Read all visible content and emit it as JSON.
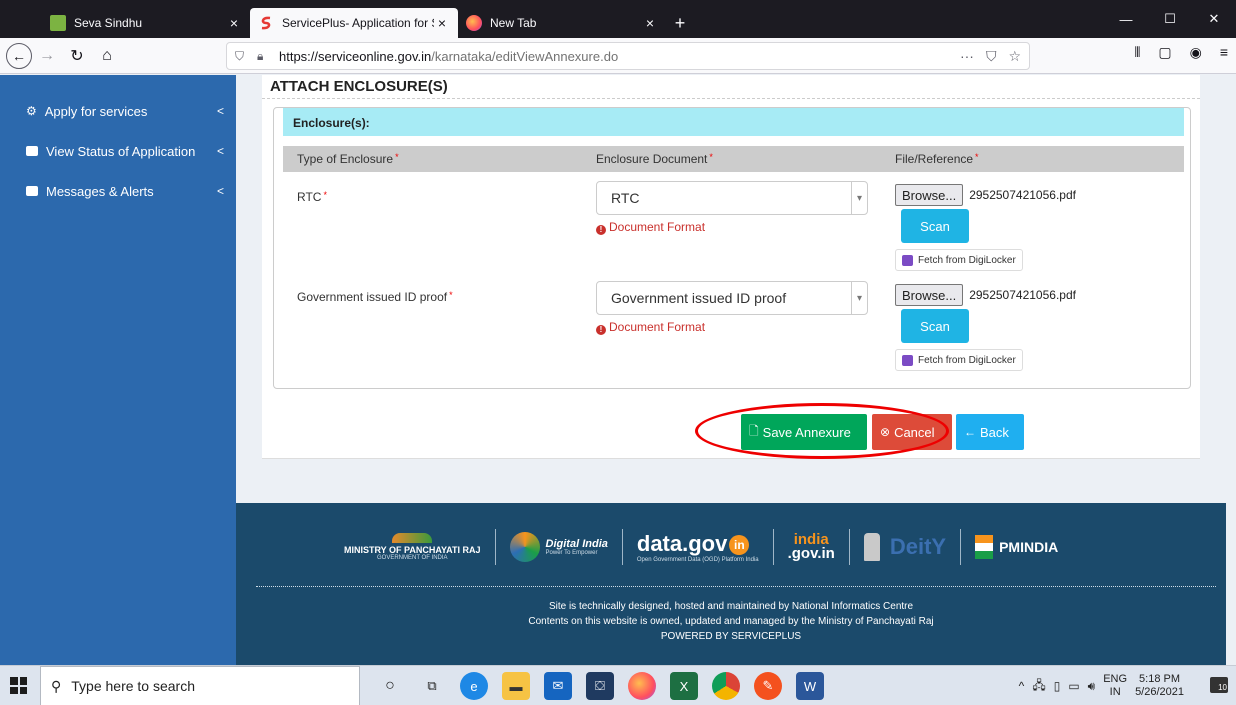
{
  "browser": {
    "tabs": [
      {
        "title": "Seva Sindhu",
        "close": "×"
      },
      {
        "title": "ServicePlus- Application for Se",
        "close": "×"
      },
      {
        "title": "New Tab",
        "close": "×"
      }
    ],
    "new_tab": "+",
    "url_domain": "https://serviceonline.gov.in",
    "url_path": "/karnataka/editViewAnnexure.do"
  },
  "sidebar": {
    "items": [
      {
        "label": "Apply for services",
        "chevron": "<"
      },
      {
        "label": "View Status of Application",
        "chevron": "<"
      },
      {
        "label": "Messages & Alerts",
        "chevron": "<"
      }
    ]
  },
  "main": {
    "heading": "ATTACH ENCLOSURE(S)",
    "box_title": "Enclosure(s):",
    "columns": [
      "Type of Enclosure",
      "Enclosure Document",
      "File/Reference"
    ],
    "required_mark": "*",
    "rows": [
      {
        "label": "RTC",
        "document": "RTC",
        "format_note": "Document Format",
        "browse": "Browse...",
        "file": "2952507421056.pdf",
        "scan": "Scan",
        "digilocker": "Fetch from DigiLocker"
      },
      {
        "label": "Government issued ID proof",
        "document": "Government issued ID proof",
        "format_note": "Document Format",
        "browse": "Browse...",
        "file": "2952507421056.pdf",
        "scan": "Scan",
        "digilocker": "Fetch from DigiLocker"
      }
    ],
    "actions": {
      "save": "Save Annexure",
      "cancel": "Cancel",
      "back": "Back"
    }
  },
  "footer": {
    "logos": {
      "panchayati": "MINISTRY OF PANCHAYATI RAJ",
      "panchayati_sub": "GOVERNMENT OF INDIA",
      "digital_india": "Digital India",
      "digital_india_sub": "Power To Empower",
      "datagov": "data.gov",
      "datagov_suffix": "in",
      "datagov_sub": "Open Government Data (OGD) Platform India",
      "indiagov_top": "india",
      "indiagov_bottom": ".gov.in",
      "deity": "DeitY",
      "pmindia": "PMINDIA"
    },
    "lines": [
      "Site is technically designed, hosted and maintained by National Informatics Centre",
      "Contents on this website is owned, updated and managed by the Ministry of Panchayati Raj",
      "POWERED BY SERVICEPLUS"
    ]
  },
  "taskbar": {
    "search_placeholder": "Type here to search",
    "lang_top": "ENG",
    "lang_bottom": "IN",
    "time": "5:18 PM",
    "date": "5/26/2021",
    "notifications": "10"
  },
  "colors": {
    "sidebar": "#2c69ad",
    "save": "#00a65a",
    "cancel": "#dd4b39",
    "back": "#1faff0",
    "scan": "#1fb4e4",
    "enclosure_header": "#a7ebf5",
    "footer": "#1b4a6b"
  }
}
